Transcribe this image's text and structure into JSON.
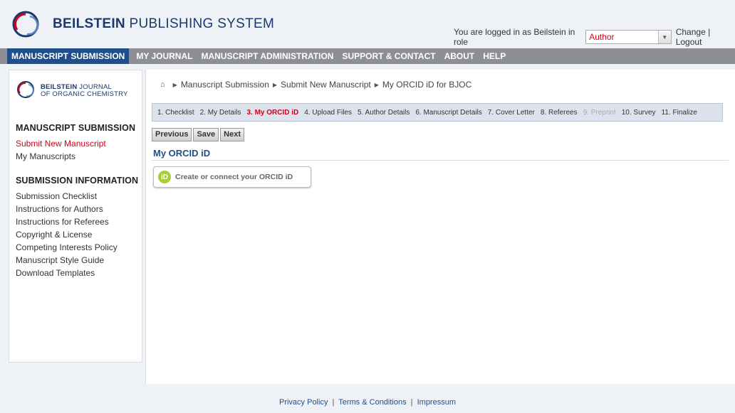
{
  "header": {
    "brand_bold": "BEILSTEIN",
    "brand_light": "PUBLISHING SYSTEM",
    "login_text": "You are logged in as Beilstein in role",
    "role_value": "Author",
    "change_label": "Change",
    "logout_label": "Logout",
    "link_sep": "|"
  },
  "nav": {
    "items": [
      {
        "label": "MANUSCRIPT SUBMISSION",
        "active": true
      },
      {
        "label": "MY JOURNAL"
      },
      {
        "label": "MANUSCRIPT ADMINISTRATION"
      },
      {
        "label": "SUPPORT & CONTACT"
      },
      {
        "label": "ABOUT"
      },
      {
        "label": "HELP"
      }
    ]
  },
  "sidebar": {
    "journal_bold": "BEILSTEIN",
    "journal_rest1": "JOURNAL",
    "journal_rest2": "OF ORGANIC CHEMISTRY",
    "section1_heading": "MANUSCRIPT SUBMISSION",
    "section1_links": [
      "Submit New Manuscript",
      "My Manuscripts"
    ],
    "section2_heading": "SUBMISSION INFORMATION",
    "section2_links": [
      "Submission Checklist",
      "Instructions for Authors",
      "Instructions for Referees",
      "Copyright & License",
      "Competing Interests Policy",
      "Manuscript Style Guide",
      "Download Templates"
    ]
  },
  "breadcrumb": [
    "Manuscript Submission",
    "Submit New Manuscript",
    "My ORCID iD for BJOC"
  ],
  "steps": [
    {
      "label": "1. Checklist"
    },
    {
      "label": "2. My Details"
    },
    {
      "label": "3. My ORCID iD",
      "current": true
    },
    {
      "label": "4. Upload Files"
    },
    {
      "label": "5. Author Details"
    },
    {
      "label": "6. Manuscript Details"
    },
    {
      "label": "7. Cover Letter"
    },
    {
      "label": "8. Referees"
    },
    {
      "label": "9. Preprint",
      "disabled": true
    },
    {
      "label": "10. Survey"
    },
    {
      "label": "11. Finalize"
    }
  ],
  "buttons": {
    "previous": "Previous",
    "save": "Save",
    "next": "Next"
  },
  "section_title": "My ORCID iD",
  "orcid": {
    "icon_text": "iD",
    "label": "Create or connect your ORCID iD",
    "icon_color": "#a6ce39"
  },
  "footer": {
    "privacy": "Privacy Policy",
    "terms": "Terms & Conditions",
    "impressum": "Impressum",
    "sep": "|"
  },
  "colors": {
    "accent": "#1f4f8b",
    "active_link": "#d0021b",
    "nav_bg": "#8d8f95"
  }
}
